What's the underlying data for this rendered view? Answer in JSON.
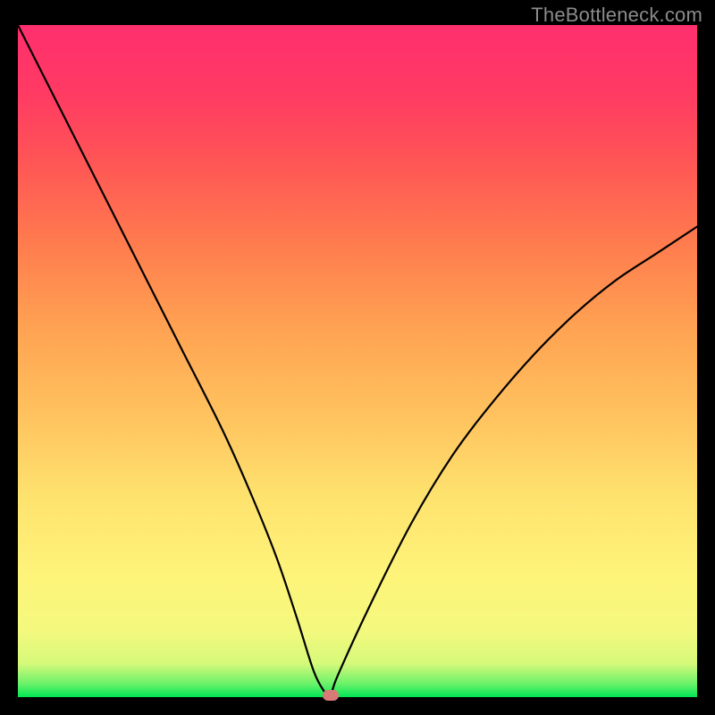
{
  "watermark": "TheBottleneck.com",
  "chart_data": {
    "type": "line",
    "title": "",
    "xlabel": "",
    "ylabel": "",
    "xlim": [
      0,
      100
    ],
    "ylim": [
      0,
      100
    ],
    "series": [
      {
        "name": "bottleneck-curve",
        "x": [
          0,
          6,
          12,
          18,
          24,
          30,
          34,
          38,
          41,
          43.5,
          45,
          46,
          47,
          52,
          58,
          64,
          70,
          76,
          82,
          88,
          94,
          100
        ],
        "values": [
          100,
          88,
          76,
          64,
          52,
          40,
          31,
          21,
          12,
          4,
          1,
          0,
          3,
          14,
          26,
          36,
          44,
          51,
          57,
          62,
          66,
          70
        ]
      }
    ],
    "marker": {
      "x": 46,
      "y": 0
    },
    "background_gradient": {
      "top": "#ff2f6e",
      "mid_high": "#ff7a4e",
      "mid": "#fee26e",
      "mid_low": "#f4f97e",
      "bottom": "#00e756"
    }
  }
}
